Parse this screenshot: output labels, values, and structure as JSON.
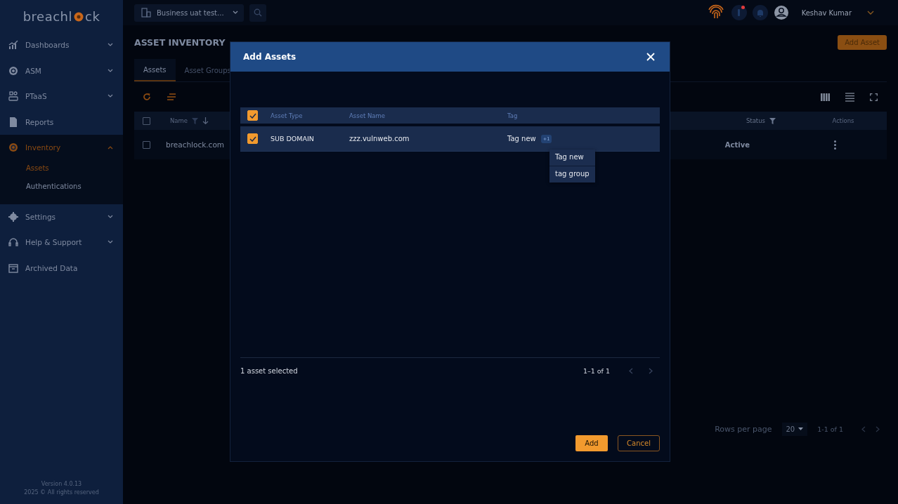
{
  "logo": {
    "before": "breachl",
    "after": "ck"
  },
  "sidebar": {
    "items": [
      {
        "label": "Dashboards",
        "expandable": true,
        "expanded": false,
        "selected": false
      },
      {
        "label": "ASM",
        "expandable": true,
        "expanded": false,
        "selected": false
      },
      {
        "label": "PTaaS",
        "expandable": true,
        "expanded": false,
        "selected": false
      },
      {
        "label": "Reports",
        "expandable": false,
        "selected": false
      },
      {
        "label": "Inventory",
        "expandable": true,
        "expanded": true,
        "selected": true,
        "children": [
          {
            "label": "Assets",
            "selected": true
          },
          {
            "label": "Authentications",
            "selected": false
          }
        ]
      },
      {
        "label": "Settings",
        "expandable": true,
        "expanded": false,
        "selected": false
      },
      {
        "label": "Help & Support",
        "expandable": true,
        "expanded": false,
        "selected": false
      },
      {
        "label": "Archived Data",
        "expandable": false,
        "selected": false
      }
    ],
    "version": "Version 4.0.13",
    "copyright": "2025 © All rights reserved"
  },
  "topbar": {
    "business": "Business uat test...",
    "user": "Keshav Kumar",
    "alert_dot": true
  },
  "page": {
    "title": "ASSET INVENTORY",
    "add_button": "Add Asset",
    "tabs": [
      {
        "label": "Assets",
        "selected": true
      },
      {
        "label": "Asset Groups",
        "selected": false
      }
    ],
    "table": {
      "all_checked": false,
      "columns": [
        "Name",
        "Status",
        "Actions"
      ],
      "rows": [
        {
          "checked": false,
          "name": "breachlock.com",
          "status": "Active"
        }
      ]
    },
    "pagination": {
      "rows_label": "Rows per page",
      "rows_value": "20",
      "range": "1-1 of 1"
    }
  },
  "modal": {
    "title": "Add Assets",
    "all_checked": true,
    "columns": [
      "Asset Type",
      "Asset Name",
      "Tag"
    ],
    "rows": [
      {
        "checked": true,
        "type": "SUB DOMAIN",
        "name": "zzz.vulnweb.com",
        "tag": "Tag new",
        "more": "+1"
      }
    ],
    "tag_popup": [
      "Tag new",
      "tag group"
    ],
    "selected_text": "1 asset selected",
    "range": "1–1 of 1",
    "buttons": {
      "primary": "Add",
      "secondary": "Cancel"
    }
  }
}
